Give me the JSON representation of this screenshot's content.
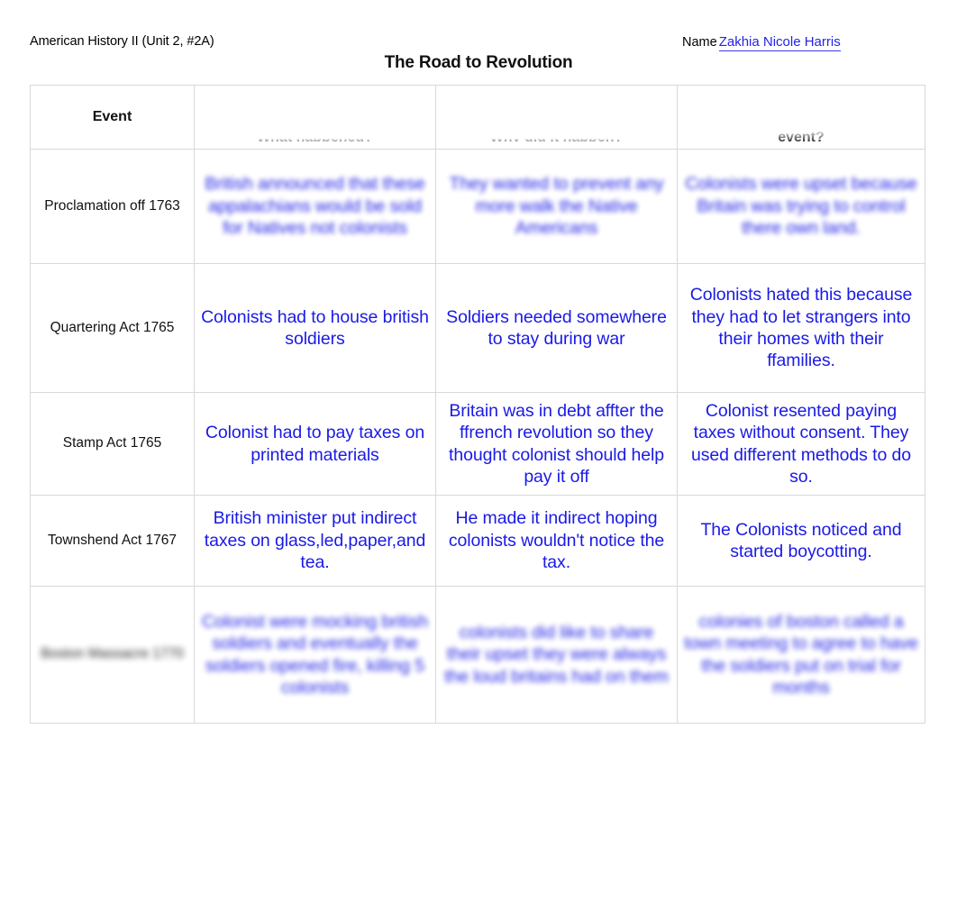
{
  "header": {
    "course": "American History II (Unit 2, #2A)",
    "name_label": "Name",
    "name_value": "Zakhia Nicole Harris"
  },
  "title": "The Road to Revolution",
  "table": {
    "columns": [
      {
        "label": "Event"
      },
      {
        "label": "What happened?"
      },
      {
        "label": "Why did it happen?"
      },
      {
        "label": "How did colonists react to this event?"
      }
    ],
    "rows": [
      {
        "event": "Proclamation off 1763",
        "what": "British announced that these appalachians would be sold for Natives not colonists",
        "why": "They wanted to prevent any more walk the Native Americans",
        "react": "Colonists were upset because Britain was trying to control there own land."
      },
      {
        "event": "Quartering Act 1765",
        "what": "Colonists had to house british soldiers",
        "why": "Soldiers needed somewhere to stay during war",
        "react": "Colonists hated this because they had to let strangers into their homes with their ffamilies."
      },
      {
        "event": "Stamp Act 1765",
        "what": "Colonist had to pay taxes on printed materials",
        "why": "Britain was in debt affter the ffrench revolution so they thought colonist should help pay it off",
        "react": "Colonist resented paying taxes without consent. They used different methods to do so."
      },
      {
        "event": "Townshend Act 1767",
        "what": "British minister put indirect taxes on glass,led,paper,and tea.",
        "why": "He made it indirect hoping colonists wouldn't notice the tax.",
        "react": "The Colonists noticed and started boycotting."
      },
      {
        "event": "Boston Massacre 1770",
        "what": "Colonist were mocking british soldiers and eventually the soldiers opened fire, killing 5 colonists",
        "why": "colonists did like to share their upset they were always the loud britains had on them",
        "react": "colonies of boston called a town meeting to agree to have the soldiers put on trial for months"
      }
    ]
  },
  "colors": {
    "answer_text": "#1a1ae6",
    "static_text": "#111111",
    "border": "#d8d8dd"
  }
}
